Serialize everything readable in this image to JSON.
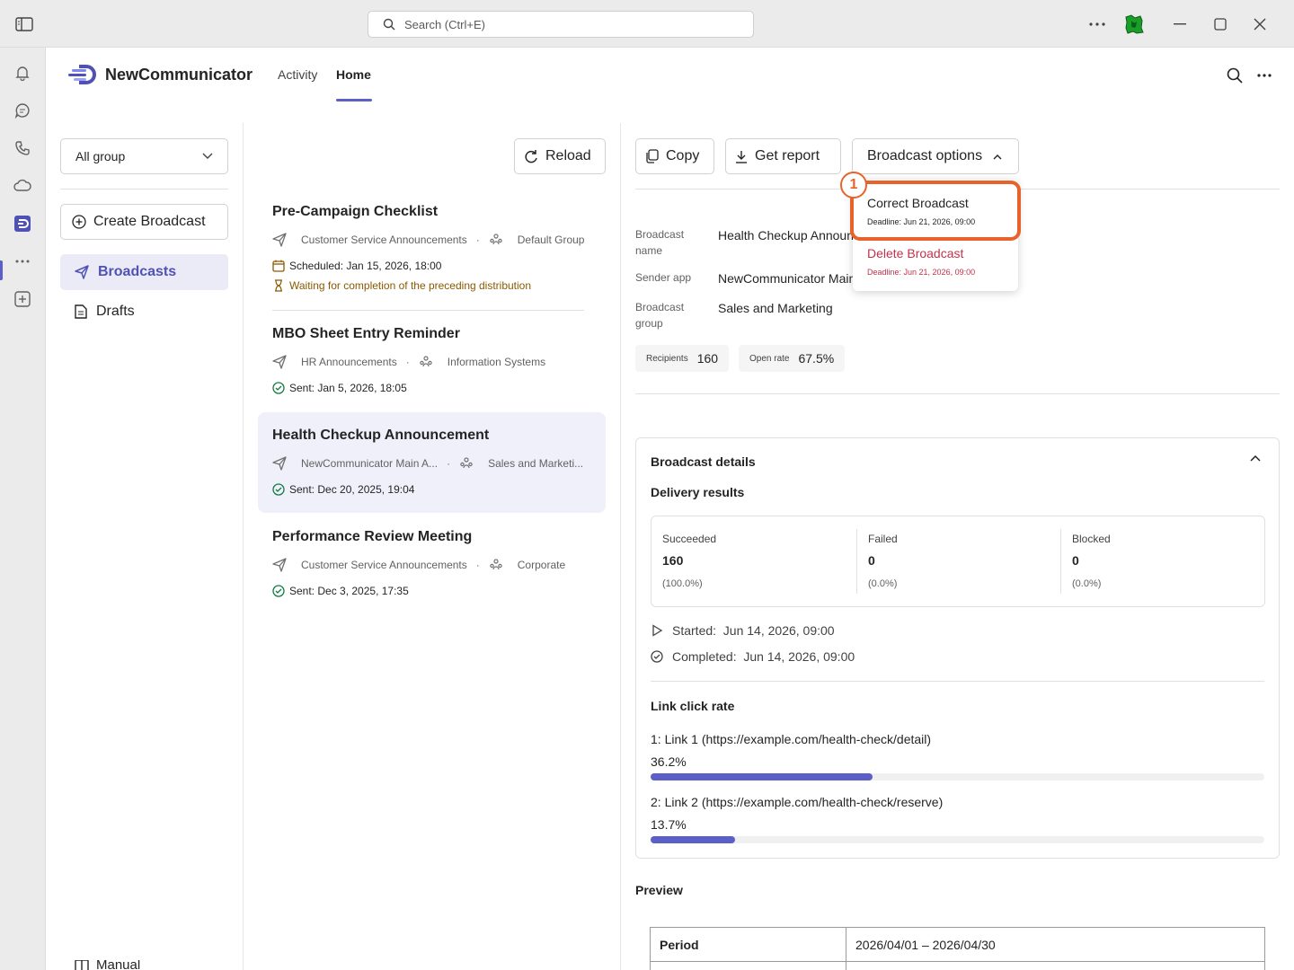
{
  "search": {
    "placeholder": "Search (Ctrl+E)"
  },
  "app": {
    "name": "NewCommunicator",
    "tabs": [
      "Activity",
      "Home"
    ],
    "active_tab": "Home"
  },
  "left": {
    "group_select": "All group",
    "create": "Create Broadcast",
    "nav": [
      "Broadcasts",
      "Drafts"
    ],
    "manual": "Manual"
  },
  "reload": "Reload",
  "broadcasts": [
    {
      "title": "Pre-Campaign Checklist",
      "channel": "Customer Service Announcements",
      "group": "Default Group",
      "status": "Scheduled: Jan 15, 2026, 18:00",
      "note": "Waiting for completion of the preceding distribution"
    },
    {
      "title": "MBO Sheet Entry Reminder",
      "channel": "HR Announcements",
      "group": "Information Systems",
      "status": "Sent: Jan 5, 2026, 18:05"
    },
    {
      "title": "Health Checkup Announcement",
      "channel": "NewCommunicator Main A...",
      "group": "Sales and Marketi...",
      "status": "Sent: Dec 20, 2025, 19:04"
    },
    {
      "title": "Performance Review Meeting",
      "channel": "Customer Service Announcements",
      "group": "Corporate",
      "status": "Sent: Dec 3, 2025, 17:35"
    }
  ],
  "toolbar": {
    "copy": "Copy",
    "report": "Get report",
    "options": "Broadcast options"
  },
  "menu": {
    "correct": "Correct Broadcast",
    "correct_deadline": "Deadline: Jun 21, 2026, 09:00",
    "delete": "Delete Broadcast",
    "delete_deadline": "Deadline: Jun 21, 2026, 09:00",
    "badge": "1"
  },
  "detail": {
    "name_label": "Broadcast name",
    "name": "Health Checkup Announcement",
    "sender_label": "Sender app",
    "sender": "NewCommunicator Main App",
    "group_label": "Broadcast group",
    "group": "Sales and Marketing",
    "recipients_label": "Recipients",
    "recipients": "160",
    "openrate_label": "Open rate",
    "openrate": "67.5%"
  },
  "card": {
    "title": "Broadcast details",
    "delivery": "Delivery results",
    "stats": [
      {
        "label": "Succeeded",
        "value": "160",
        "pct": "(100.0%)"
      },
      {
        "label": "Failed",
        "value": "0",
        "pct": "(0.0%)"
      },
      {
        "label": "Blocked",
        "value": "0",
        "pct": "(0.0%)"
      }
    ],
    "started": "Started:  Jun 14, 2026, 09:00",
    "completed": "Completed:  Jun 14, 2026, 09:00",
    "link_title": "Link click rate",
    "links": [
      {
        "label": "1: Link 1 (https://example.com/health-check/detail)",
        "pct": "36.2%",
        "value": 0.362
      },
      {
        "label": "2: Link 2 (https://example.com/health-check/reserve)",
        "pct": "13.7%",
        "value": 0.137
      }
    ]
  },
  "preview": {
    "title": "Preview",
    "rows": [
      [
        "Period",
        "2026/04/01 – 2026/04/30"
      ],
      [
        "",
        ""
      ]
    ]
  },
  "colors": {
    "accent": "#5b5fc7",
    "highlight": "#e8632c",
    "danger": "#c4314b",
    "warning": "#8a5a00",
    "success": "#107c41"
  }
}
